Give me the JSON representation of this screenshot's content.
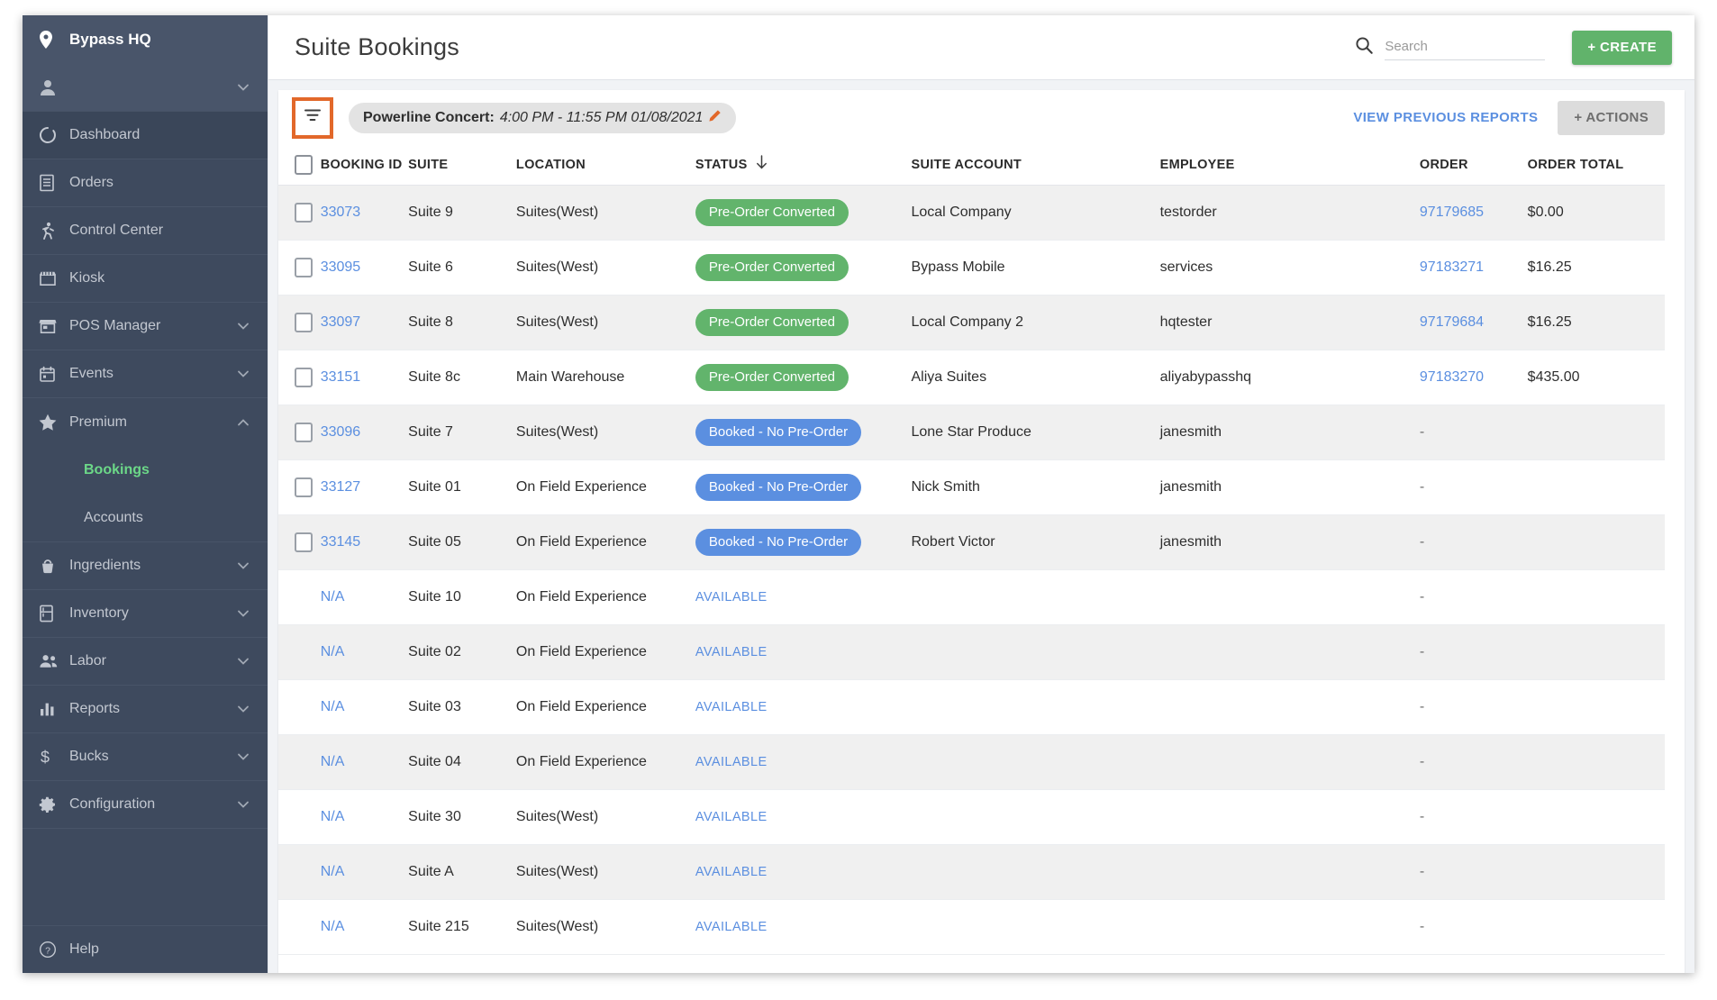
{
  "sidebar": {
    "brand": {
      "label": "Bypass HQ",
      "icon": "location-pin-icon"
    },
    "user": {
      "icon": "person-icon",
      "chevron": "chevron-down-icon"
    },
    "items": [
      {
        "label": "Dashboard",
        "icon": "dashboard-icon",
        "expandable": false,
        "active_bg": true
      },
      {
        "label": "Orders",
        "icon": "receipt-icon",
        "expandable": false
      },
      {
        "label": "Control Center",
        "icon": "runner-icon",
        "expandable": false
      },
      {
        "label": "Kiosk",
        "icon": "kiosk-icon",
        "expandable": false
      },
      {
        "label": "POS Manager",
        "icon": "store-icon",
        "expandable": true,
        "chevron": "chevron-down-icon"
      },
      {
        "label": "Events",
        "icon": "calendar-icon",
        "expandable": true,
        "chevron": "chevron-down-icon"
      },
      {
        "label": "Premium",
        "icon": "star-icon",
        "expandable": true,
        "chevron": "chevron-up-icon",
        "expanded": true
      },
      {
        "label": "Ingredients",
        "icon": "basket-icon",
        "expandable": true,
        "chevron": "chevron-down-icon"
      },
      {
        "label": "Inventory",
        "icon": "fridge-icon",
        "expandable": true,
        "chevron": "chevron-down-icon"
      },
      {
        "label": "Labor",
        "icon": "people-icon",
        "expandable": true,
        "chevron": "chevron-down-icon"
      },
      {
        "label": "Reports",
        "icon": "bar-chart-icon",
        "expandable": true,
        "chevron": "chevron-down-icon"
      },
      {
        "label": "Bucks",
        "icon": "dollar-icon",
        "expandable": true,
        "chevron": "chevron-down-icon"
      },
      {
        "label": "Configuration",
        "icon": "gear-icon",
        "expandable": true,
        "chevron": "chevron-down-icon"
      }
    ],
    "premium_children": [
      {
        "label": "Bookings",
        "active": true
      },
      {
        "label": "Accounts",
        "active": false
      }
    ],
    "help": {
      "label": "Help",
      "icon": "question-circle-icon"
    },
    "colors": {
      "bg": "#3e4a5e",
      "header_bg": "#49556a",
      "active_text": "#6cd888",
      "text": "#c3c8d1"
    }
  },
  "header": {
    "title": "Suite Bookings",
    "search": {
      "placeholder": "Search",
      "value": "",
      "icon": "search-icon"
    },
    "create_button": "+ CREATE",
    "create_color": "#61b36b"
  },
  "filterbar": {
    "filter_icon": "filter-icon",
    "filter_highlight_color": "#e2682a",
    "event": {
      "name": "Powerline Concert:",
      "time": "4:00 PM - 11:55 PM 01/08/2021",
      "edit_icon": "pencil-icon"
    },
    "view_previous_reports": "VIEW PREVIOUS REPORTS",
    "actions_button": "+ ACTIONS"
  },
  "table": {
    "columns": [
      {
        "key": "check",
        "label": ""
      },
      {
        "key": "booking_id",
        "label": "BOOKING ID"
      },
      {
        "key": "suite",
        "label": "SUITE"
      },
      {
        "key": "location",
        "label": "LOCATION"
      },
      {
        "key": "status",
        "label": "STATUS",
        "sorted": true,
        "sort_dir": "desc",
        "sort_icon": "arrow-down-icon"
      },
      {
        "key": "suite_account",
        "label": "SUITE ACCOUNT"
      },
      {
        "key": "employee",
        "label": "EMPLOYEE"
      },
      {
        "key": "order",
        "label": "ORDER"
      },
      {
        "key": "order_total",
        "label": "ORDER TOTAL"
      }
    ],
    "status_colors": {
      "pre_order_converted": "#62b46c",
      "booked_no_preorder": "#5b8fe0",
      "available": "#5b8fe0"
    },
    "rows": [
      {
        "checkbox": true,
        "booking_id": "33073",
        "suite": "Suite 9",
        "location": "Suites(West)",
        "status": "Pre-Order Converted",
        "status_style": "green",
        "suite_account": "Local Company",
        "employee": "testorder",
        "order": "97179685",
        "order_link": true,
        "order_total": "$0.00"
      },
      {
        "checkbox": true,
        "booking_id": "33095",
        "suite": "Suite 6",
        "location": "Suites(West)",
        "status": "Pre-Order Converted",
        "status_style": "green",
        "suite_account": "Bypass Mobile",
        "employee": "services",
        "order": "97183271",
        "order_link": true,
        "order_total": "$16.25"
      },
      {
        "checkbox": true,
        "booking_id": "33097",
        "suite": "Suite 8",
        "location": "Suites(West)",
        "status": "Pre-Order Converted",
        "status_style": "green",
        "suite_account": "Local Company 2",
        "employee": "hqtester",
        "order": "97179684",
        "order_link": true,
        "order_total": "$16.25"
      },
      {
        "checkbox": true,
        "booking_id": "33151",
        "suite": "Suite 8c",
        "location": "Main Warehouse",
        "status": "Pre-Order Converted",
        "status_style": "green",
        "suite_account": "Aliya Suites",
        "employee": "aliyabypasshq",
        "order": "97183270",
        "order_link": true,
        "order_total": "$435.00"
      },
      {
        "checkbox": true,
        "booking_id": "33096",
        "suite": "Suite 7",
        "location": "Suites(West)",
        "status": "Booked - No Pre-Order",
        "status_style": "blue",
        "suite_account": "Lone Star Produce",
        "employee": "janesmith",
        "order": "-",
        "order_link": false,
        "order_total": ""
      },
      {
        "checkbox": true,
        "booking_id": "33127",
        "suite": "Suite 01",
        "location": "On Field Experience",
        "status": "Booked - No Pre-Order",
        "status_style": "blue",
        "suite_account": "Nick Smith",
        "employee": "janesmith",
        "order": "-",
        "order_link": false,
        "order_total": ""
      },
      {
        "checkbox": true,
        "booking_id": "33145",
        "suite": "Suite 05",
        "location": "On Field Experience",
        "status": "Booked - No Pre-Order",
        "status_style": "blue",
        "suite_account": "Robert Victor",
        "employee": "janesmith",
        "order": "-",
        "order_link": false,
        "order_total": ""
      },
      {
        "checkbox": false,
        "booking_id": "N/A",
        "suite": "Suite 10",
        "location": "On Field Experience",
        "status": "AVAILABLE",
        "status_style": "text",
        "suite_account": "",
        "employee": "",
        "order": "-",
        "order_link": false,
        "order_total": ""
      },
      {
        "checkbox": false,
        "booking_id": "N/A",
        "suite": "Suite 02",
        "location": "On Field Experience",
        "status": "AVAILABLE",
        "status_style": "text",
        "suite_account": "",
        "employee": "",
        "order": "-",
        "order_link": false,
        "order_total": ""
      },
      {
        "checkbox": false,
        "booking_id": "N/A",
        "suite": "Suite 03",
        "location": "On Field Experience",
        "status": "AVAILABLE",
        "status_style": "text",
        "suite_account": "",
        "employee": "",
        "order": "-",
        "order_link": false,
        "order_total": ""
      },
      {
        "checkbox": false,
        "booking_id": "N/A",
        "suite": "Suite 04",
        "location": "On Field Experience",
        "status": "AVAILABLE",
        "status_style": "text",
        "suite_account": "",
        "employee": "",
        "order": "-",
        "order_link": false,
        "order_total": ""
      },
      {
        "checkbox": false,
        "booking_id": "N/A",
        "suite": "Suite 30",
        "location": "Suites(West)",
        "status": "AVAILABLE",
        "status_style": "text",
        "suite_account": "",
        "employee": "",
        "order": "-",
        "order_link": false,
        "order_total": ""
      },
      {
        "checkbox": false,
        "booking_id": "N/A",
        "suite": "Suite A",
        "location": "Suites(West)",
        "status": "AVAILABLE",
        "status_style": "text",
        "suite_account": "",
        "employee": "",
        "order": "-",
        "order_link": false,
        "order_total": ""
      },
      {
        "checkbox": false,
        "booking_id": "N/A",
        "suite": "Suite 215",
        "location": "Suites(West)",
        "status": "AVAILABLE",
        "status_style": "text",
        "suite_account": "",
        "employee": "",
        "order": "-",
        "order_link": false,
        "order_total": ""
      }
    ]
  }
}
